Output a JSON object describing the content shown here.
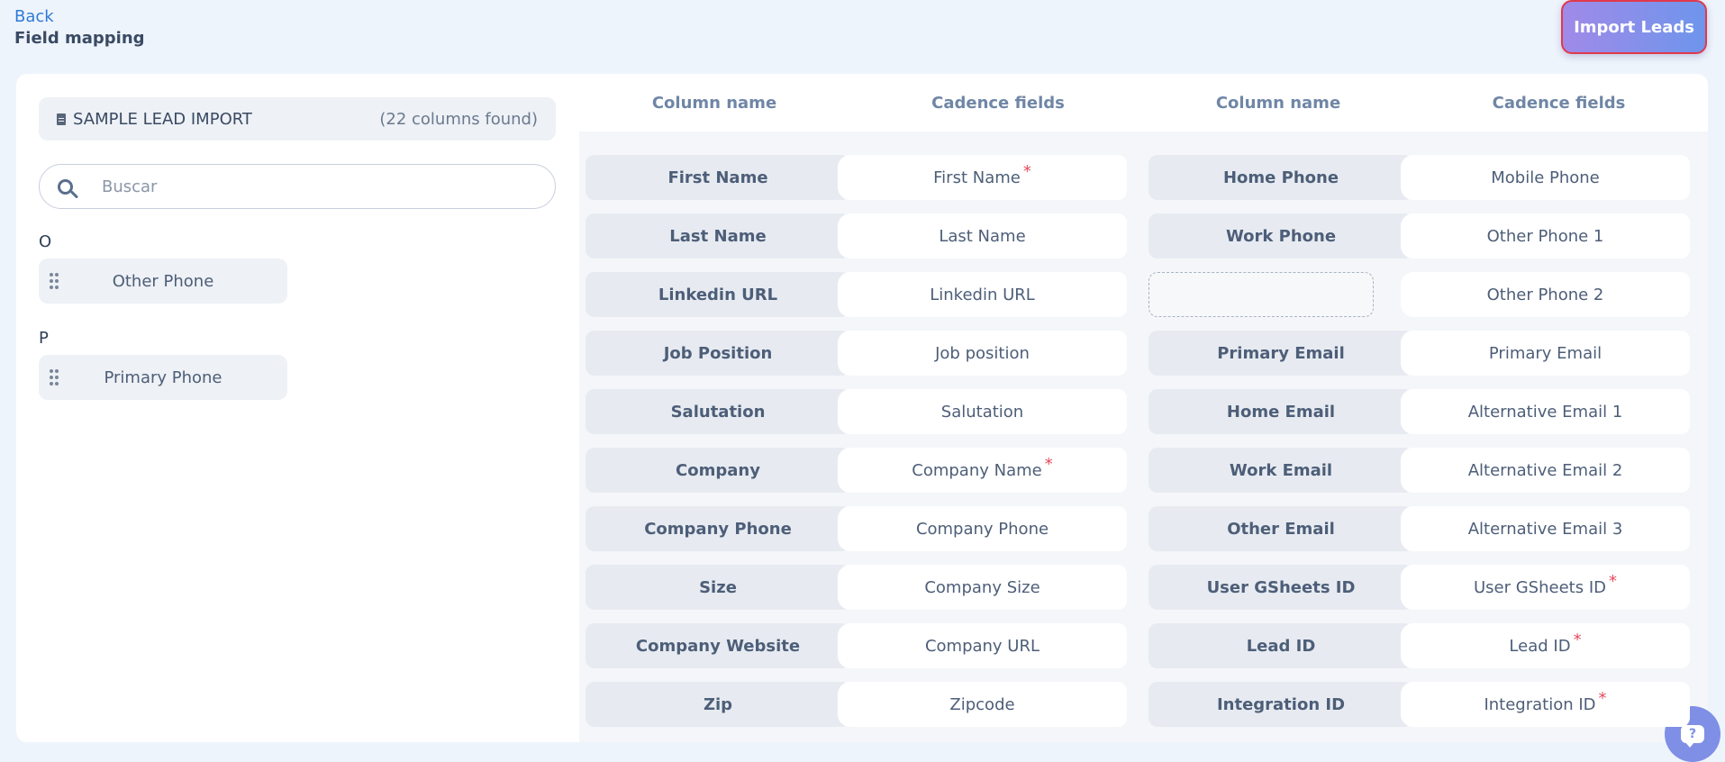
{
  "header": {
    "back_label": "Back",
    "title": "Field mapping",
    "import_button": "Import Leads"
  },
  "file": {
    "name": "SAMPLE LEAD IMPORT",
    "columns_found": "(22 columns found)"
  },
  "search": {
    "placeholder": "Buscar"
  },
  "groups": [
    {
      "letter": "O",
      "items": [
        "Other Phone"
      ]
    },
    {
      "letter": "P",
      "items": [
        "Primary Phone"
      ]
    }
  ],
  "table": {
    "headers": [
      "Column name",
      "Cadence fields",
      "Column name",
      "Cadence fields"
    ],
    "rows": [
      {
        "left_col": "First Name",
        "left_field": "First Name",
        "left_req": "*",
        "right_col": "Home Phone",
        "right_field": "Mobile Phone",
        "right_req": ""
      },
      {
        "left_col": "Last Name",
        "left_field": "Last Name",
        "left_req": "",
        "right_col": "Work Phone",
        "right_field": "Other Phone 1",
        "right_req": ""
      },
      {
        "left_col": "Linkedin URL",
        "left_field": "Linkedin URL",
        "left_req": "",
        "right_col": "",
        "right_field": "Other Phone 2",
        "right_req": ""
      },
      {
        "left_col": "Job Position",
        "left_field": "Job position",
        "left_req": "",
        "right_col": "Primary Email",
        "right_field": "Primary Email",
        "right_req": ""
      },
      {
        "left_col": "Salutation",
        "left_field": "Salutation",
        "left_req": "",
        "right_col": "Home Email",
        "right_field": "Alternative Email 1",
        "right_req": ""
      },
      {
        "left_col": "Company",
        "left_field": "Company Name",
        "left_req": "*",
        "right_col": "Work Email",
        "right_field": "Alternative Email 2",
        "right_req": ""
      },
      {
        "left_col": "Company Phone",
        "left_field": "Company Phone",
        "left_req": "",
        "right_col": "Other Email",
        "right_field": "Alternative Email 3",
        "right_req": ""
      },
      {
        "left_col": "Size",
        "left_field": "Company Size",
        "left_req": "",
        "right_col": "User GSheets ID",
        "right_field": "User GSheets ID",
        "right_req": "*"
      },
      {
        "left_col": "Company Website",
        "left_field": "Company URL",
        "left_req": "",
        "right_col": "Lead ID",
        "right_field": "Lead ID",
        "right_req": "*"
      },
      {
        "left_col": "Zip",
        "left_field": "Zipcode",
        "left_req": "",
        "right_col": "Integration ID",
        "right_field": "Integration ID",
        "right_req": "*"
      }
    ]
  },
  "help": {
    "icon": "help-chat-icon",
    "glyph": "?"
  }
}
